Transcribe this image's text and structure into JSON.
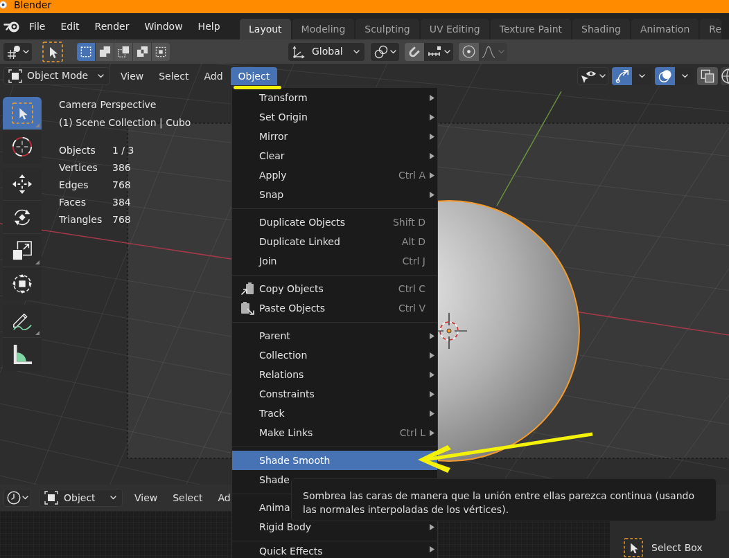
{
  "window": {
    "title": "Blender"
  },
  "menu_bar": {
    "items": [
      "File",
      "Edit",
      "Render",
      "Window",
      "Help"
    ]
  },
  "workspace_tabs": [
    {
      "label": "Layout",
      "selected": true
    },
    {
      "label": "Modeling",
      "selected": false
    },
    {
      "label": "Sculpting",
      "selected": false
    },
    {
      "label": "UV Editing",
      "selected": false
    },
    {
      "label": "Texture Paint",
      "selected": false
    },
    {
      "label": "Shading",
      "selected": false
    },
    {
      "label": "Animation",
      "selected": false
    },
    {
      "label": "Re",
      "selected": false
    }
  ],
  "tool_header": {
    "select_modes": [
      {
        "kind": "set",
        "selected": true
      },
      {
        "kind": "extend",
        "selected": false
      },
      {
        "kind": "subtract",
        "selected": false
      },
      {
        "kind": "difference",
        "selected": false
      },
      {
        "kind": "intersect",
        "selected": false
      }
    ],
    "orientation": "Global",
    "snap": {
      "on": false
    },
    "proportional_editing": {
      "on": false
    }
  },
  "viewport": {
    "header": {
      "mode": "Object Mode",
      "menus": [
        {
          "label": "View",
          "selected": false
        },
        {
          "label": "Select",
          "selected": false
        },
        {
          "label": "Add",
          "selected": false
        },
        {
          "label": "Object",
          "selected": true
        }
      ],
      "gizmos": {
        "on": true
      },
      "overlays": {
        "on": true
      },
      "xray": {
        "on": false
      }
    },
    "tool_groups": [
      {
        "tools": [
          {
            "kind": "select",
            "selected": true,
            "has_more_tools": true
          },
          {
            "kind": "cursor",
            "selected": false,
            "has_more_tools": false
          }
        ]
      },
      {
        "tools": [
          {
            "kind": "move",
            "selected": false,
            "has_more_tools": false
          },
          {
            "kind": "rotate",
            "selected": false,
            "has_more_tools": false
          },
          {
            "kind": "scale",
            "selected": false,
            "has_more_tools": true
          },
          {
            "kind": "transform",
            "selected": false,
            "has_more_tools": false
          }
        ]
      },
      {
        "tools": [
          {
            "kind": "annotate",
            "selected": false,
            "has_more_tools": true
          },
          {
            "kind": "measure",
            "selected": false,
            "has_more_tools": false
          }
        ]
      }
    ],
    "view_name": "Camera Perspective",
    "collection": "(1) Scene Collection | Cubo",
    "statistics": [
      {
        "label": "Objects",
        "value": "1 / 3"
      },
      {
        "label": "Vertices",
        "value": "386"
      },
      {
        "label": "Edges",
        "value": "768"
      },
      {
        "label": "Faces",
        "value": "384"
      },
      {
        "label": "Triangles",
        "value": "768"
      }
    ]
  },
  "object_menu": {
    "sections": [
      {
        "items": [
          {
            "label": "Transform",
            "kind": "plain",
            "has_submenu": true,
            "selected": false
          },
          {
            "label": "Set Origin",
            "kind": "plain",
            "has_submenu": true,
            "selected": false
          },
          {
            "label": "Mirror",
            "kind": "plain",
            "has_submenu": true,
            "selected": false
          },
          {
            "label": "Clear",
            "kind": "plain",
            "has_submenu": true,
            "selected": false
          },
          {
            "label": "Apply",
            "shortcut": "Ctrl A",
            "kind": "plain",
            "has_submenu": true,
            "selected": false
          },
          {
            "label": "Snap",
            "kind": "plain",
            "has_submenu": true,
            "selected": false
          }
        ]
      },
      {
        "items": [
          {
            "label": "Duplicate Objects",
            "shortcut": "Shift D",
            "kind": "plain",
            "has_submenu": false,
            "selected": false
          },
          {
            "label": "Duplicate Linked",
            "shortcut": "Alt D",
            "kind": "plain",
            "has_submenu": false,
            "selected": false
          },
          {
            "label": "Join",
            "shortcut": "Ctrl J",
            "kind": "plain",
            "has_submenu": false,
            "selected": false
          }
        ]
      },
      {
        "items": [
          {
            "label": "Copy Objects",
            "shortcut": "Ctrl C",
            "kind": "copy",
            "has_submenu": false,
            "selected": false
          },
          {
            "label": "Paste Objects",
            "shortcut": "Ctrl V",
            "kind": "paste",
            "has_submenu": false,
            "selected": false
          }
        ]
      },
      {
        "items": [
          {
            "label": "Parent",
            "kind": "plain",
            "has_submenu": true,
            "selected": false
          },
          {
            "label": "Collection",
            "kind": "plain",
            "has_submenu": true,
            "selected": false
          },
          {
            "label": "Relations",
            "kind": "plain",
            "has_submenu": true,
            "selected": false
          },
          {
            "label": "Constraints",
            "kind": "plain",
            "has_submenu": true,
            "selected": false
          },
          {
            "label": "Track",
            "kind": "plain",
            "has_submenu": true,
            "selected": false
          },
          {
            "label": "Make Links",
            "shortcut": "Ctrl L",
            "kind": "plain",
            "has_submenu": true,
            "selected": false
          }
        ]
      },
      {
        "items": [
          {
            "label": "Shade Smooth",
            "kind": "plain",
            "has_submenu": false,
            "selected": true
          },
          {
            "label": "Shade",
            "kind": "plain",
            "has_submenu": false,
            "selected": false
          }
        ]
      },
      {
        "items": [
          {
            "label": "Anima",
            "kind": "plain",
            "has_submenu": false,
            "selected": false
          },
          {
            "label": "Rigid Body",
            "kind": "plain",
            "has_submenu": true,
            "selected": false
          }
        ]
      },
      {
        "items": [
          {
            "label": "Quick Effects",
            "kind": "plain",
            "has_submenu": true,
            "selected": false
          }
        ]
      }
    ]
  },
  "tooltip": {
    "text": "Sombrea las caras de manera que la unión entre ellas parezca continua (usando las normales interpoladas de los vértices)."
  },
  "bottom_editor": {
    "header": {
      "object": "Object",
      "menus": [
        "View",
        "Select",
        "Ad"
      ]
    },
    "active_tool": {
      "name": "Select Box"
    }
  }
}
